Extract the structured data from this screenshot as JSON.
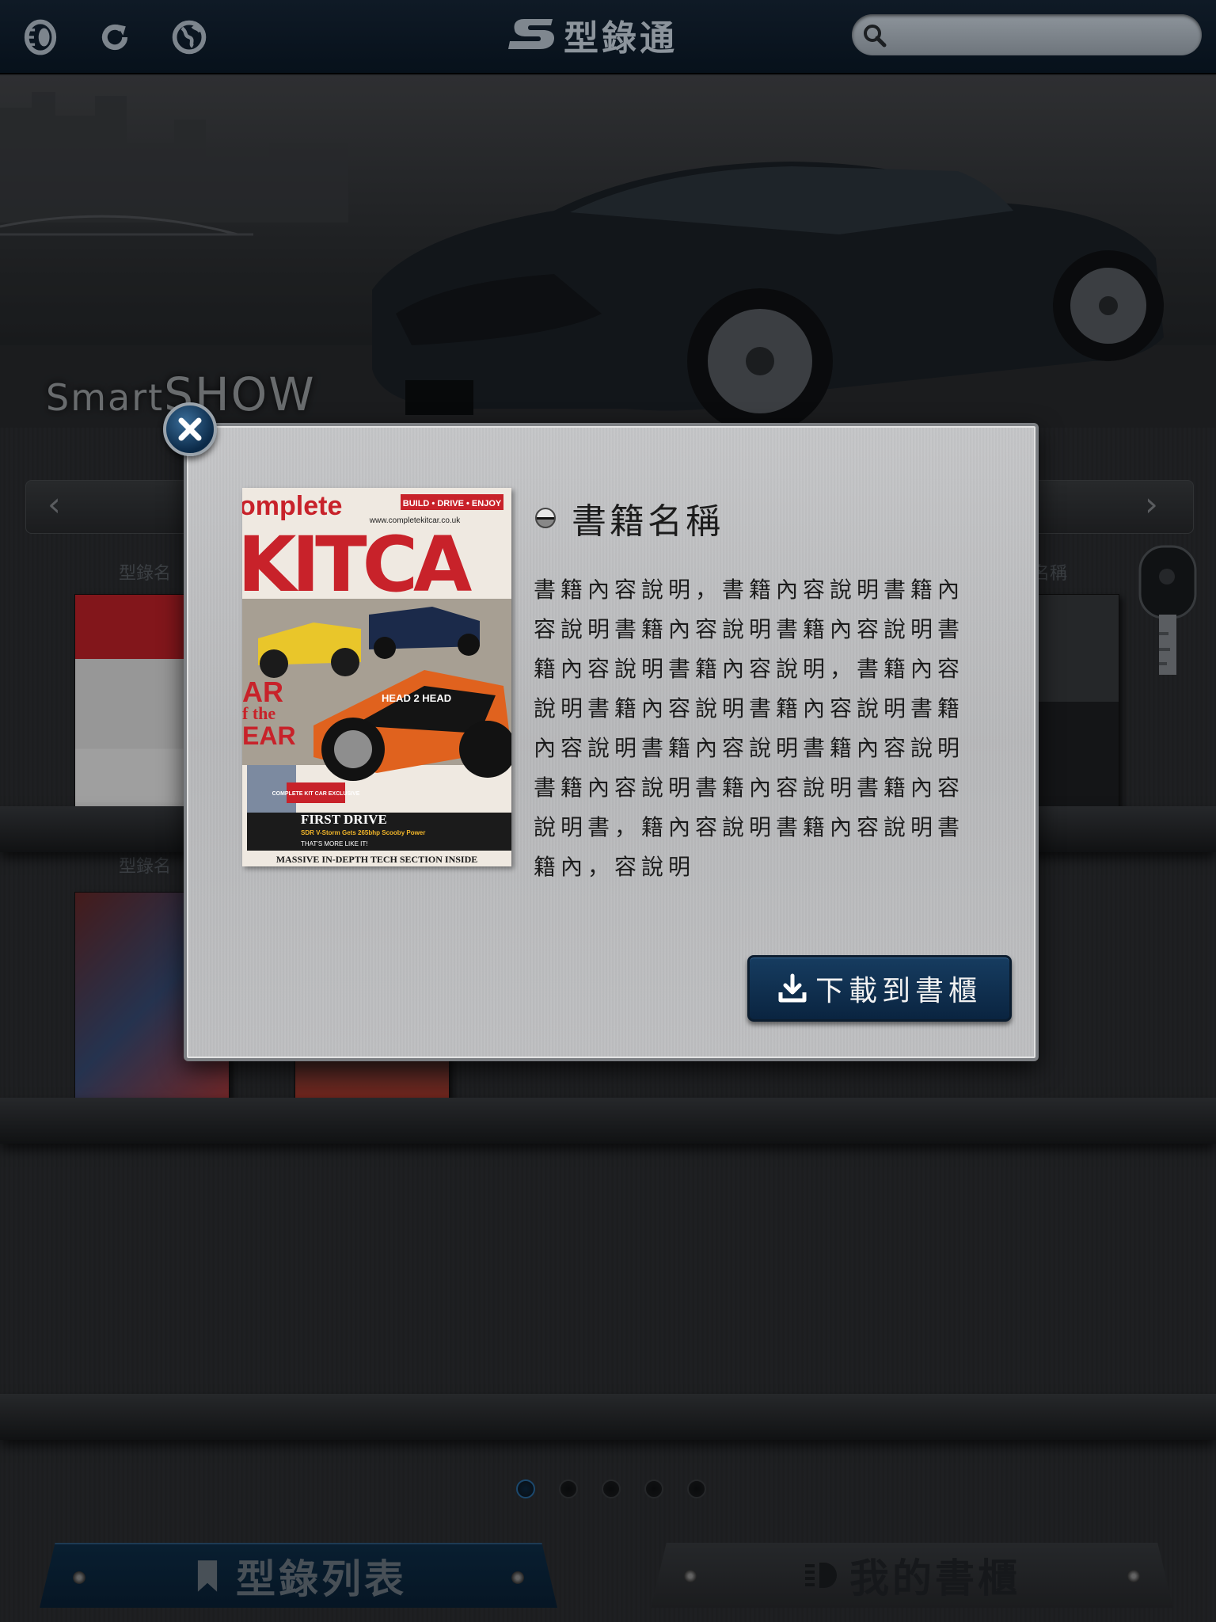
{
  "app": {
    "logo_text": "型錄通",
    "search_placeholder": ""
  },
  "banner": {
    "title_prefix": "Smart",
    "title_main": "SHOW"
  },
  "shelves": {
    "labels": [
      "型錄名",
      "型錄名",
      "型錄名稱"
    ]
  },
  "pagination": {
    "total": 5,
    "active": 1
  },
  "bottom_tabs": {
    "list_label": "型錄列表",
    "shelf_label": "我的書櫃"
  },
  "modal": {
    "book_title": "書籍名稱",
    "description": "書籍內容說明，書籍內容說明書籍內容說明書籍內容說明書籍內容說明書籍內容說明書籍內容說明，書籍內容說明書籍內容說明書籍內容說明書籍內容說明書籍內容說明書籍內容說明書籍內容說明書籍內容說明書籍內容說明書，籍內容說明書籍內容說明書籍內，容說明",
    "download_label": "下載到書櫃",
    "cover": {
      "brand_top": "omplete",
      "brand_main": "KITCA",
      "tagline": "BUILD • DRIVE • ENJOY",
      "url": "www.completekitcar.co.uk",
      "left_text": "AR",
      "left_text2": "f the",
      "left_text3": "EAR",
      "head2head": "HEAD 2 HEAD",
      "badge": "COMPLETE KIT CAR EXCLUSIVE",
      "first_drive": "FIRST DRIVE",
      "fd_sub": "SDR V-Storm Gets 265bhp Scooby Power",
      "more": "THAT'S MORE LIKE IT!",
      "bottom": "MASSIVE IN-DEPTH TECH SECTION INSIDE"
    }
  },
  "colors": {
    "topbar": "#0b1621",
    "accent_blue": "#0e2f4b",
    "modal_metal": "#c0c1c3"
  }
}
